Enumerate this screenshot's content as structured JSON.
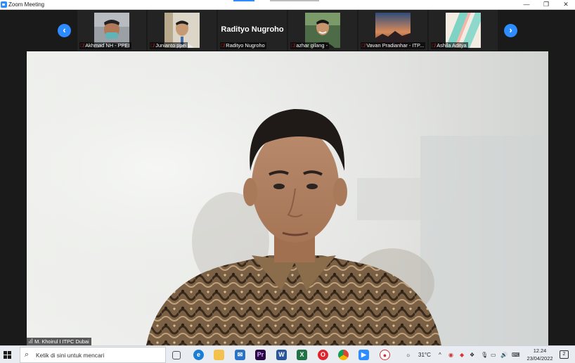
{
  "window": {
    "title": "Zoom Meeting",
    "minimize": "—",
    "maximize": "❐",
    "close": "✕"
  },
  "strip": {
    "prev_arrow": "‹",
    "next_arrow": "›",
    "participants": [
      {
        "name": "Akhmad NH - PPEI",
        "muted": true
      },
      {
        "name": "Junianto ppei",
        "muted": true
      },
      {
        "name": "Radityo Nugroho",
        "muted": true,
        "video_off_label": "Radityo Nugroho"
      },
      {
        "name": "azhar gilang -",
        "muted": true
      },
      {
        "name": "Vavan Pradianhar - ITP...",
        "muted": true
      },
      {
        "name": "Ashila Aditya",
        "muted": true
      }
    ]
  },
  "main": {
    "speaker_name": "M. Khoirul I ITPC Dubai"
  },
  "taskbar": {
    "search_placeholder": "Ketik di sini untuk mencari",
    "temperature": "31°C",
    "time": "12.24",
    "date": "23/04/2022",
    "notification_count": "2",
    "apps": [
      "task-view",
      "edge",
      "file-explorer",
      "mail",
      "premiere",
      "word",
      "excel",
      "opera",
      "chrome",
      "zoom",
      "app"
    ]
  },
  "colors": {
    "zoom_blue": "#2d8cff",
    "muted_red": "#e02828",
    "dark_bg": "#1a1a1a"
  }
}
